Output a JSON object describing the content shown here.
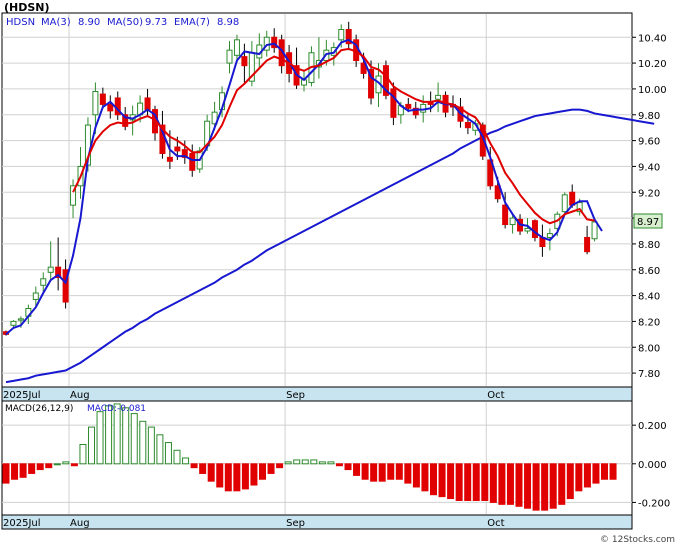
{
  "title": "(HDSN)",
  "legend": {
    "symbol": "HDSN",
    "ma3_label": "MA(3)",
    "ma3_value": "8.90",
    "ma50_label": "MA(50)",
    "ma50_value": "9.73",
    "ema7_label": "EMA(7)",
    "ema7_value": "8.98"
  },
  "last_price": "8.97",
  "macd_legend": {
    "params": "MACD(26,12,9)",
    "value": "MACD:-0.081"
  },
  "watermark": "© 12Stocks.com",
  "colors": {
    "up": "#2e8b2e",
    "down": "#e00000",
    "ma": "#1818d0",
    "ema": "#e00000",
    "axis_band": "#c8e4f0",
    "price_tag": "#d8f0d0"
  },
  "chart_data": [
    {
      "type": "candlestick",
      "title": "(HDSN)",
      "dates": [
        "2025-07-01",
        "2025-07-02",
        "2025-07-03",
        "2025-07-07",
        "2025-07-08",
        "2025-07-09",
        "2025-07-10",
        "2025-07-11",
        "2025-07-14",
        "2025-07-15",
        "2025-07-16",
        "2025-07-17",
        "2025-07-18",
        "2025-07-21",
        "2025-07-22",
        "2025-07-23",
        "2025-07-24",
        "2025-07-25",
        "2025-07-28",
        "2025-07-29",
        "2025-07-30",
        "2025-07-31",
        "2025-08-01",
        "2025-08-04",
        "2025-08-05",
        "2025-08-06",
        "2025-08-07",
        "2025-08-08",
        "2025-08-11",
        "2025-08-12",
        "2025-08-13",
        "2025-08-14",
        "2025-08-15",
        "2025-08-18",
        "2025-08-19",
        "2025-08-20",
        "2025-08-21",
        "2025-08-22",
        "2025-08-25",
        "2025-08-26",
        "2025-08-27",
        "2025-08-28",
        "2025-08-29",
        "2025-09-02",
        "2025-09-03",
        "2025-09-04",
        "2025-09-05",
        "2025-09-08",
        "2025-09-09",
        "2025-09-10",
        "2025-09-11",
        "2025-09-12",
        "2025-09-15",
        "2025-09-16",
        "2025-09-17",
        "2025-09-18",
        "2025-09-19",
        "2025-09-22",
        "2025-09-23",
        "2025-09-24",
        "2025-09-25",
        "2025-09-26",
        "2025-09-29",
        "2025-09-30",
        "2025-10-01",
        "2025-10-02",
        "2025-10-03",
        "2025-10-06",
        "2025-10-07",
        "2025-10-08",
        "2025-10-09",
        "2025-10-10",
        "2025-10-13",
        "2025-10-14",
        "2025-10-15",
        "2025-10-16",
        "2025-10-17",
        "2025-10-20",
        "2025-10-21",
        "2025-10-22",
        "2025-10-23",
        "2025-10-24"
      ],
      "ohlc": [
        [
          8.12,
          8.13,
          8.09,
          8.1
        ],
        [
          8.17,
          8.21,
          8.15,
          8.2
        ],
        [
          8.21,
          8.24,
          8.15,
          8.22
        ],
        [
          8.24,
          8.33,
          8.18,
          8.3
        ],
        [
          8.37,
          8.47,
          8.32,
          8.42
        ],
        [
          8.48,
          8.58,
          8.43,
          8.53
        ],
        [
          8.58,
          8.82,
          8.52,
          8.62
        ],
        [
          8.62,
          8.85,
          8.44,
          8.54
        ],
        [
          8.6,
          8.68,
          8.3,
          8.35
        ],
        [
          9.1,
          9.3,
          9.0,
          9.25
        ],
        [
          9.25,
          9.55,
          9.15,
          9.4
        ],
        [
          9.41,
          9.78,
          9.36,
          9.72
        ],
        [
          9.8,
          10.05,
          9.65,
          9.98
        ],
        [
          9.96,
          10.01,
          9.85,
          9.88
        ],
        [
          9.88,
          9.95,
          9.77,
          9.83
        ],
        [
          9.93,
          9.98,
          9.76,
          9.8
        ],
        [
          9.8,
          9.86,
          9.68,
          9.71
        ],
        [
          9.76,
          9.87,
          9.64,
          9.8
        ],
        [
          9.8,
          9.95,
          9.74,
          9.89
        ],
        [
          9.93,
          10.0,
          9.78,
          9.84
        ],
        [
          9.84,
          9.87,
          9.6,
          9.66
        ],
        [
          9.72,
          9.83,
          9.46,
          9.5
        ],
        [
          9.47,
          9.68,
          9.38,
          9.44
        ],
        [
          9.55,
          9.63,
          9.45,
          9.52
        ],
        [
          9.53,
          9.6,
          9.42,
          9.47
        ],
        [
          9.5,
          9.57,
          9.32,
          9.37
        ],
        [
          9.38,
          9.55,
          9.35,
          9.52
        ],
        [
          9.56,
          9.8,
          9.52,
          9.75
        ],
        [
          9.73,
          9.9,
          9.68,
          9.82
        ],
        [
          9.84,
          10.02,
          9.78,
          9.97
        ],
        [
          10.2,
          10.37,
          10.12,
          10.3
        ],
        [
          10.26,
          10.42,
          10.2,
          10.38
        ],
        [
          10.25,
          10.35,
          10.05,
          10.18
        ],
        [
          10.06,
          10.37,
          10.02,
          10.28
        ],
        [
          10.24,
          10.43,
          10.15,
          10.34
        ],
        [
          10.3,
          10.45,
          10.25,
          10.4
        ],
        [
          10.4,
          10.47,
          10.28,
          10.32
        ],
        [
          10.38,
          10.42,
          10.12,
          10.18
        ],
        [
          10.28,
          10.34,
          10.05,
          10.12
        ],
        [
          10.18,
          10.32,
          10.0,
          10.03
        ],
        [
          10.03,
          10.15,
          9.98,
          10.07
        ],
        [
          10.05,
          10.33,
          10.02,
          10.28
        ],
        [
          10.17,
          10.4,
          10.08,
          10.22
        ],
        [
          10.22,
          10.38,
          10.18,
          10.3
        ],
        [
          10.26,
          10.36,
          10.18,
          10.32
        ],
        [
          10.38,
          10.5,
          10.32,
          10.46
        ],
        [
          10.46,
          10.52,
          10.3,
          10.35
        ],
        [
          10.38,
          10.42,
          10.17,
          10.22
        ],
        [
          10.2,
          10.28,
          10.08,
          10.12
        ],
        [
          10.15,
          10.22,
          9.88,
          9.93
        ],
        [
          9.97,
          10.2,
          9.86,
          10.1
        ],
        [
          10.18,
          10.22,
          9.92,
          9.95
        ],
        [
          10.0,
          10.05,
          9.72,
          9.78
        ],
        [
          9.8,
          9.9,
          9.73,
          9.87
        ],
        [
          9.88,
          9.93,
          9.82,
          9.85
        ],
        [
          9.85,
          9.9,
          9.77,
          9.8
        ],
        [
          9.82,
          9.95,
          9.74,
          9.88
        ],
        [
          9.9,
          9.98,
          9.82,
          9.88
        ],
        [
          9.92,
          10.05,
          9.82,
          9.95
        ],
        [
          9.95,
          9.98,
          9.78,
          9.82
        ],
        [
          9.88,
          9.95,
          9.79,
          9.86
        ],
        [
          9.86,
          9.93,
          9.7,
          9.75
        ],
        [
          9.74,
          9.8,
          9.65,
          9.7
        ],
        [
          9.68,
          9.76,
          9.64,
          9.73
        ],
        [
          9.72,
          9.74,
          9.45,
          9.48
        ],
        [
          9.45,
          9.55,
          9.22,
          9.25
        ],
        [
          9.25,
          9.32,
          9.12,
          9.15
        ],
        [
          9.1,
          9.2,
          8.92,
          8.95
        ],
        [
          8.95,
          9.03,
          8.88,
          9.0
        ],
        [
          8.99,
          9.03,
          8.87,
          8.9
        ],
        [
          8.9,
          9.0,
          8.88,
          8.92
        ],
        [
          8.98,
          8.99,
          8.82,
          8.85
        ],
        [
          8.85,
          8.95,
          8.7,
          8.78
        ],
        [
          8.85,
          8.92,
          8.75,
          8.88
        ],
        [
          8.92,
          9.05,
          8.86,
          9.03
        ],
        [
          9.05,
          9.2,
          9.02,
          9.18
        ],
        [
          9.2,
          9.26,
          9.08,
          9.1
        ],
        [
          9.05,
          9.15,
          9.02,
          9.12
        ],
        [
          8.85,
          8.94,
          8.72,
          8.74
        ],
        [
          8.84,
          8.97,
          8.82,
          8.97
        ]
      ],
      "ma3": [
        8.1,
        8.15,
        8.17,
        8.24,
        8.31,
        8.42,
        8.52,
        8.56,
        8.5,
        8.71,
        9.0,
        9.46,
        9.7,
        9.86,
        9.9,
        9.84,
        9.78,
        9.77,
        9.8,
        9.84,
        9.8,
        9.67,
        9.53,
        9.48,
        9.48,
        9.45,
        9.45,
        9.55,
        9.7,
        9.85,
        10.03,
        10.22,
        10.29,
        10.28,
        10.27,
        10.34,
        10.35,
        10.3,
        10.21,
        10.11,
        10.07,
        10.13,
        10.19,
        10.27,
        10.28,
        10.36,
        10.38,
        10.34,
        10.23,
        10.09,
        10.05,
        9.99,
        9.94,
        9.87,
        9.83,
        9.84,
        9.84,
        9.85,
        9.9,
        9.88,
        9.88,
        9.81,
        9.77,
        9.73,
        9.63,
        9.47,
        9.29,
        9.12,
        9.03,
        8.95,
        8.94,
        8.89,
        8.85,
        8.83,
        8.89,
        9.03,
        9.1,
        9.13,
        9.13,
        8.99,
        8.9
      ],
      "ma50": [
        7.73,
        7.74,
        7.75,
        7.76,
        7.78,
        7.79,
        7.8,
        7.81,
        7.82,
        7.85,
        7.88,
        7.92,
        7.96,
        8.0,
        8.04,
        8.08,
        8.12,
        8.15,
        8.19,
        8.22,
        8.26,
        8.29,
        8.32,
        8.35,
        8.38,
        8.41,
        8.44,
        8.47,
        8.5,
        8.54,
        8.57,
        8.6,
        8.64,
        8.67,
        8.71,
        8.75,
        8.78,
        8.81,
        8.84,
        8.87,
        8.9,
        8.93,
        8.96,
        8.99,
        9.02,
        9.05,
        9.08,
        9.11,
        9.14,
        9.17,
        9.2,
        9.23,
        9.26,
        9.29,
        9.32,
        9.35,
        9.38,
        9.41,
        9.44,
        9.47,
        9.5,
        9.54,
        9.57,
        9.6,
        9.63,
        9.66,
        9.68,
        9.71,
        9.73,
        9.75,
        9.77,
        9.79,
        9.8,
        9.81,
        9.82,
        9.83,
        9.84,
        9.84,
        9.83,
        9.81,
        9.8,
        9.79,
        9.78,
        9.77,
        9.76,
        9.75,
        9.74,
        9.73
      ],
      "ema7": [
        9.2,
        9.32,
        9.47,
        9.6,
        9.67,
        9.72,
        9.74,
        9.73,
        9.74,
        9.77,
        9.79,
        9.76,
        9.69,
        9.63,
        9.6,
        9.56,
        9.51,
        9.51,
        9.57,
        9.63,
        9.72,
        9.86,
        9.99,
        10.04,
        10.1,
        10.16,
        10.22,
        10.25,
        10.23,
        10.2,
        10.16,
        10.14,
        10.17,
        10.18,
        10.21,
        10.24,
        10.3,
        10.31,
        10.29,
        10.25,
        10.17,
        10.15,
        10.1,
        10.02,
        9.98,
        9.95,
        9.92,
        9.9,
        9.9,
        9.91,
        9.89,
        9.88,
        9.85,
        9.81,
        9.78,
        9.7,
        9.58,
        9.48,
        9.35,
        9.27,
        9.18,
        9.11,
        9.04,
        8.99,
        8.96,
        8.98,
        9.03,
        9.05,
        9.07,
        8.99,
        8.98
      ],
      "ylim": [
        7.7,
        10.58
      ],
      "yticks": [
        "10.40",
        "10.20",
        "10.00",
        "9.80",
        "9.60",
        "9.40",
        "9.20",
        "9.00",
        "8.80",
        "8.60",
        "8.40",
        "8.20",
        "8.00",
        "7.80"
      ],
      "xticks": [
        "2025Jul",
        "Aug",
        "Sep",
        "Oct"
      ],
      "grid": true
    },
    {
      "type": "bar",
      "title": "MACD(26,12,9)",
      "values": [
        -0.1,
        -0.08,
        -0.07,
        -0.05,
        -0.03,
        -0.02,
        0.0,
        0.01,
        -0.01,
        0.1,
        0.19,
        0.27,
        0.3,
        0.31,
        0.29,
        0.26,
        0.22,
        0.19,
        0.15,
        0.11,
        0.07,
        0.03,
        -0.02,
        -0.05,
        -0.09,
        -0.12,
        -0.14,
        -0.14,
        -0.13,
        -0.11,
        -0.08,
        -0.05,
        -0.02,
        0.01,
        0.02,
        0.02,
        0.02,
        0.01,
        0.01,
        -0.01,
        -0.03,
        -0.06,
        -0.08,
        -0.09,
        -0.09,
        -0.08,
        -0.08,
        -0.1,
        -0.12,
        -0.14,
        -0.16,
        -0.17,
        -0.18,
        -0.19,
        -0.19,
        -0.19,
        -0.19,
        -0.2,
        -0.21,
        -0.21,
        -0.22,
        -0.23,
        -0.24,
        -0.24,
        -0.23,
        -0.21,
        -0.18,
        -0.14,
        -0.12,
        -0.1,
        -0.08,
        -0.08
      ],
      "ylim": [
        -0.26,
        0.32
      ],
      "yticks": [
        "0.200",
        "0.000",
        "-0.200"
      ],
      "xticks": [
        "2025Jul",
        "Aug",
        "Sep",
        "Oct"
      ]
    }
  ]
}
